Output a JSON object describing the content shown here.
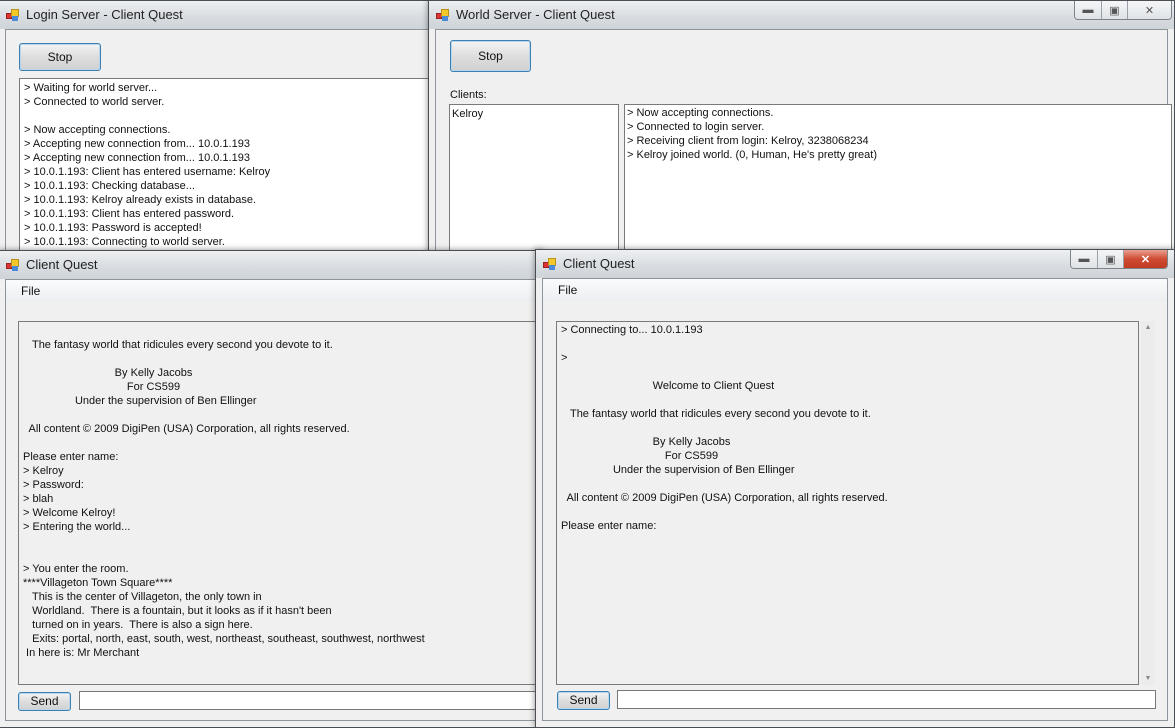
{
  "login_server": {
    "title": "Login Server - Client Quest",
    "stop_label": "Stop",
    "log": [
      "> Waiting for world server...",
      "> Connected to world server.",
      "",
      "> Now accepting connections.",
      "> Accepting new connection from... 10.0.1.193",
      "> Accepting new connection from... 10.0.1.193",
      "> 10.0.1.193: Client has entered username: Kelroy",
      "> 10.0.1.193: Checking database...",
      "> 10.0.1.193: Kelroy already exists in database.",
      "> 10.0.1.193: Client has entered password.",
      "> 10.0.1.193: Password is accepted!",
      "> 10.0.1.193: Connecting to world server."
    ]
  },
  "world_server": {
    "title": "World Server - Client Quest",
    "stop_label": "Stop",
    "clients_label": "Clients:",
    "clients": [
      "Kelroy"
    ],
    "log": [
      "> Now accepting connections.",
      "> Connected to login server.",
      "> Receiving client from login: Kelroy, 3238068234",
      "> Kelroy joined world. (0, Human, He's pretty great)"
    ],
    "caption_buttons": {
      "minimize": "minimize-icon",
      "maximize": "maximize-icon",
      "close": "close-icon"
    }
  },
  "client_left": {
    "title": "Client Quest",
    "menu_file": "File",
    "send_label": "Send",
    "input_value": "",
    "log": [
      "",
      "   The fantasy world that ridicules every second you devote to it.",
      "",
      "                              By Kelly Jacobs",
      "                                  For CS599",
      "                 Under the supervision of Ben Ellinger",
      "",
      "  All content © 2009 DigiPen (USA) Corporation, all rights reserved.",
      "",
      "Please enter name:",
      "> Kelroy",
      "> Password:",
      "> blah",
      "> Welcome Kelroy!",
      "> Entering the world...",
      "",
      "",
      "> You enter the room.",
      "****Villageton Town Square****",
      "   This is the center of Villageton, the only town in",
      "   Worldland.  There is a fountain, but it looks as if it hasn't been",
      "   turned on in years.  There is also a sign here.",
      "   Exits: portal, north, east, south, west, northeast, southeast, southwest, northwest",
      " In here is: Mr Merchant"
    ]
  },
  "client_right": {
    "title": "Client Quest",
    "menu_file": "File",
    "send_label": "Send",
    "input_value": "",
    "log": [
      "> Connecting to... 10.0.1.193",
      "",
      ">",
      "",
      "                              Welcome to Client Quest",
      "",
      "   The fantasy world that ridicules every second you devote to it.",
      "",
      "                              By Kelly Jacobs",
      "                                  For CS599",
      "                 Under the supervision of Ben Ellinger",
      "",
      "  All content © 2009 DigiPen (USA) Corporation, all rights reserved.",
      "",
      "Please enter name:"
    ],
    "caption_buttons": {
      "minimize": "minimize-icon",
      "maximize": "maximize-icon",
      "close": "close-icon"
    }
  }
}
